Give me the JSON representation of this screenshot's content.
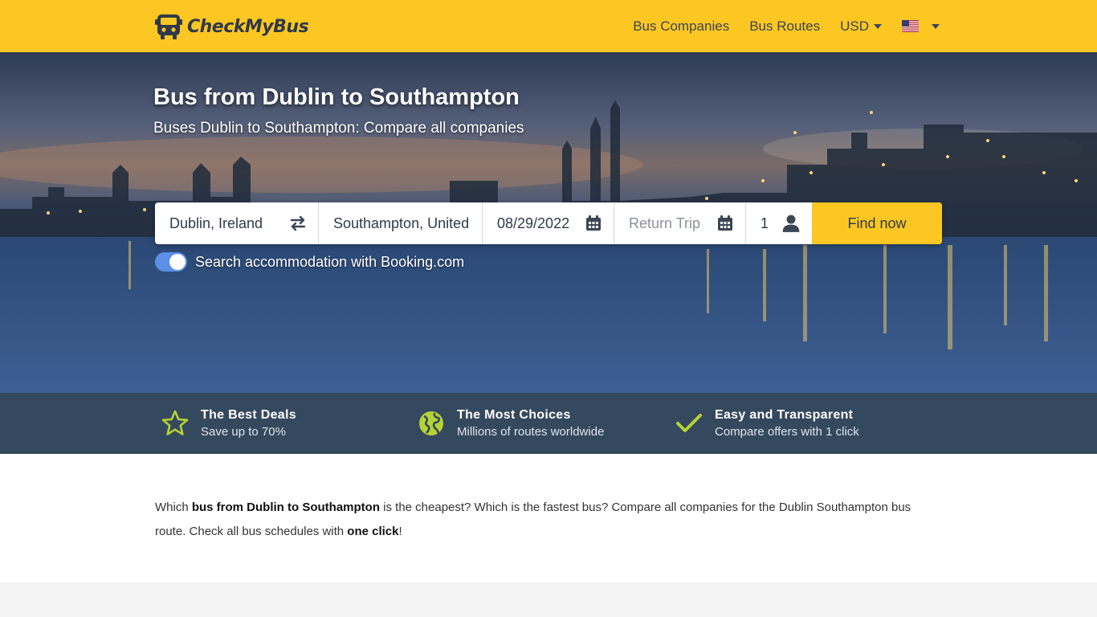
{
  "header": {
    "logo_text": "CheckMyBus",
    "nav": {
      "bus_companies": "Bus Companies",
      "bus_routes": "Bus Routes",
      "currency": "USD"
    }
  },
  "hero": {
    "title": "Bus from Dublin to Southampton",
    "subtitle": "Buses Dublin to Southampton: Compare all companies"
  },
  "search": {
    "from": "Dublin, Ireland",
    "to": "Southampton, United",
    "date": "08/29/2022",
    "return_placeholder": "Return Trip",
    "passengers": "1",
    "submit_label": "Find now",
    "accommodation_label": "Search accommodation with Booking.com",
    "accommodation_enabled": true
  },
  "features": [
    {
      "title": "The Best Deals",
      "subtitle": "Save up to 70%",
      "icon": "star-icon"
    },
    {
      "title": "The Most Choices",
      "subtitle": "Millions of routes worldwide",
      "icon": "globe-icon"
    },
    {
      "title": "Easy and Transparent",
      "subtitle": "Compare offers with 1 click",
      "icon": "check-icon"
    }
  ],
  "intro": {
    "p1": "Which ",
    "b1": "bus from Dublin to Southampton",
    "p2": " is the cheapest? Which is the fastest bus? Compare all companies for the Dublin Southampton bus route. Check all bus schedules with ",
    "b2": "one click",
    "p3": "!"
  },
  "colors": {
    "brand_yellow": "#fdc723",
    "band_navy": "#34495e",
    "feature_icon_green": "#b5d334",
    "toggle_blue": "#5c8fe6"
  }
}
